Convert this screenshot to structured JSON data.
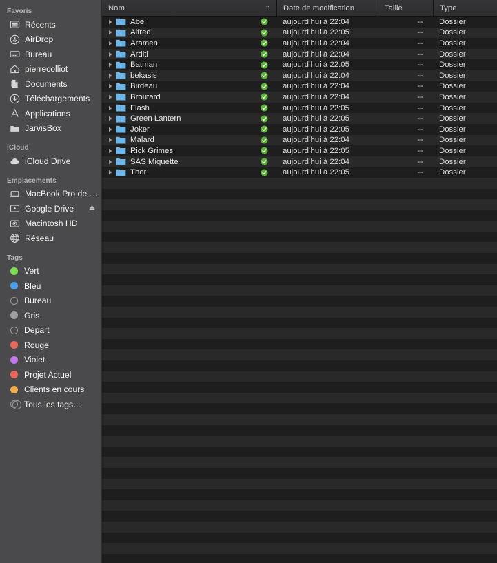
{
  "sidebar": {
    "sections": [
      {
        "title": "Favoris",
        "items": [
          {
            "label": "Récents",
            "icon": "recents-icon"
          },
          {
            "label": "AirDrop",
            "icon": "airdrop-icon"
          },
          {
            "label": "Bureau",
            "icon": "desktop-icon"
          },
          {
            "label": "pierrecolliot",
            "icon": "home-icon"
          },
          {
            "label": "Documents",
            "icon": "documents-icon"
          },
          {
            "label": "Téléchargements",
            "icon": "downloads-icon"
          },
          {
            "label": "Applications",
            "icon": "applications-icon"
          },
          {
            "label": "JarvisBox",
            "icon": "folder-icon"
          }
        ]
      },
      {
        "title": "iCloud",
        "items": [
          {
            "label": "iCloud Drive",
            "icon": "icloud-icon"
          }
        ]
      },
      {
        "title": "Emplacements",
        "items": [
          {
            "label": "MacBook Pro de Pi…",
            "icon": "laptop-icon"
          },
          {
            "label": "Google Drive",
            "icon": "external-drive-icon",
            "eject": true
          },
          {
            "label": "Macintosh HD",
            "icon": "harddisk-icon"
          },
          {
            "label": "Réseau",
            "icon": "network-icon"
          }
        ]
      },
      {
        "title": "Tags",
        "items": [
          {
            "label": "Vert",
            "icon": "tag-dot",
            "color": "#7ddc56"
          },
          {
            "label": "Bleu",
            "icon": "tag-dot",
            "color": "#4a9eea"
          },
          {
            "label": "Bureau",
            "icon": "tag-dot",
            "color": "hollow"
          },
          {
            "label": "Gris",
            "icon": "tag-dot",
            "color": "#9e9ea0"
          },
          {
            "label": "Départ",
            "icon": "tag-dot",
            "color": "hollow"
          },
          {
            "label": "Rouge",
            "icon": "tag-dot",
            "color": "#e8675c"
          },
          {
            "label": "Violet",
            "icon": "tag-dot",
            "color": "#c07ae8"
          },
          {
            "label": "Projet Actuel",
            "icon": "tag-dot",
            "color": "#e8675c"
          },
          {
            "label": "Clients en cours",
            "icon": "tag-dot",
            "color": "#f0ad4e"
          },
          {
            "label": "Tous les tags…",
            "icon": "tag-dot",
            "color": "multi"
          }
        ]
      }
    ]
  },
  "filelist": {
    "columns": [
      {
        "key": "name",
        "label": "Nom",
        "sorted": true,
        "sort_direction": "asc",
        "sort_glyph": "⌃"
      },
      {
        "key": "date",
        "label": "Date de modification",
        "sorted": false
      },
      {
        "key": "size",
        "label": "Taille",
        "sorted": false
      },
      {
        "key": "type",
        "label": "Type",
        "sorted": false
      }
    ],
    "rows": [
      {
        "name": "Abel",
        "date": "aujourd’hui à 22:04",
        "size": "--",
        "type": "Dossier",
        "status": "synced",
        "expandable": true
      },
      {
        "name": "Alfred",
        "date": "aujourd’hui à 22:05",
        "size": "--",
        "type": "Dossier",
        "status": "synced",
        "expandable": true
      },
      {
        "name": "Aramen",
        "date": "aujourd’hui à 22:04",
        "size": "--",
        "type": "Dossier",
        "status": "synced",
        "expandable": true
      },
      {
        "name": "Arditi",
        "date": "aujourd’hui à 22:04",
        "size": "--",
        "type": "Dossier",
        "status": "synced",
        "expandable": true
      },
      {
        "name": "Batman",
        "date": "aujourd’hui à 22:05",
        "size": "--",
        "type": "Dossier",
        "status": "synced",
        "expandable": true
      },
      {
        "name": "bekasis",
        "date": "aujourd’hui à 22:04",
        "size": "--",
        "type": "Dossier",
        "status": "synced",
        "expandable": true
      },
      {
        "name": "Birdeau",
        "date": "aujourd’hui à 22:04",
        "size": "--",
        "type": "Dossier",
        "status": "synced",
        "expandable": true
      },
      {
        "name": "Broutard",
        "date": "aujourd’hui à 22:04",
        "size": "--",
        "type": "Dossier",
        "status": "synced",
        "expandable": true
      },
      {
        "name": "Flash",
        "date": "aujourd’hui à 22:05",
        "size": "--",
        "type": "Dossier",
        "status": "synced",
        "expandable": true
      },
      {
        "name": "Green Lantern",
        "date": "aujourd’hui à 22:05",
        "size": "--",
        "type": "Dossier",
        "status": "synced",
        "expandable": true
      },
      {
        "name": "Joker",
        "date": "aujourd’hui à 22:05",
        "size": "--",
        "type": "Dossier",
        "status": "synced",
        "expandable": true
      },
      {
        "name": "Malard",
        "date": "aujourd’hui à 22:04",
        "size": "--",
        "type": "Dossier",
        "status": "synced",
        "expandable": true
      },
      {
        "name": "Rick Grimes",
        "date": "aujourd’hui à 22:05",
        "size": "--",
        "type": "Dossier",
        "status": "synced",
        "expandable": true
      },
      {
        "name": "SAS Miquette",
        "date": "aujourd’hui à 22:04",
        "size": "--",
        "type": "Dossier",
        "status": "synced",
        "expandable": true
      },
      {
        "name": "Thor",
        "date": "aujourd’hui à 22:05",
        "size": "--",
        "type": "Dossier",
        "status": "synced",
        "expandable": true
      }
    ]
  },
  "colors": {
    "sidebar_bg": "#4a4a4c",
    "list_bg": "#1e1e1e",
    "stripe_bg": "#292929",
    "header_bg": "#2d2d2f",
    "folder_blue": "#6cb5e8",
    "sync_green": "#5cb338"
  }
}
